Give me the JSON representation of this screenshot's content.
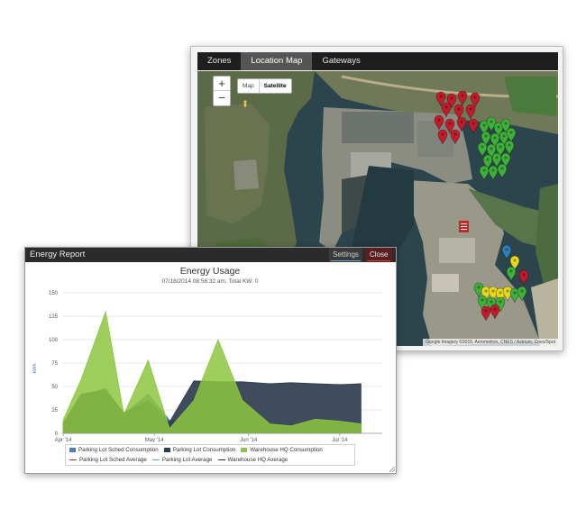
{
  "map_window": {
    "tabs": [
      {
        "label": "Zones",
        "active": false
      },
      {
        "label": "Location Map",
        "active": true
      },
      {
        "label": "Gateways",
        "active": false
      }
    ],
    "zoom_in": "+",
    "zoom_out": "−",
    "map_types": {
      "map": "Map",
      "satellite": "Satellite",
      "selected": "satellite"
    },
    "attribution": "Google Imagery ©2015, Aerometrex, CNES / Astrium, Cnes/Spot",
    "marker_colors": {
      "red": "#c21b2a",
      "green": "#3fae3a",
      "yellow": "#e6d81f",
      "blue": "#2f7fb5"
    }
  },
  "report_window": {
    "title": "Energy Report",
    "settings_label": "Settings",
    "close_label": "Close",
    "chart_data": {
      "type": "area",
      "title": "Energy Usage",
      "subtitle": "07/18/2014 08:56:32 am, Total KW: 0",
      "ylabel": "kWh",
      "ylim": [
        0,
        150
      ],
      "yticks": [
        0,
        25,
        50,
        75,
        100,
        125,
        150
      ],
      "x_tick_labels": [
        "Apr '14",
        "May '14",
        "Jun '14",
        "Jul '14"
      ],
      "x": [
        "2014-04-01",
        "2014-04-07",
        "2014-04-15",
        "2014-04-21",
        "2014-04-29",
        "2014-05-06",
        "2014-05-14",
        "2014-05-22",
        "2014-05-30",
        "2014-06-08",
        "2014-06-15",
        "2014-06-23",
        "2014-07-01",
        "2014-07-08"
      ],
      "series": [
        {
          "name": "Parking Lot Sched Consumption",
          "color": "#4a7fb8",
          "values": [
            10,
            40,
            48,
            20,
            42,
            14,
            10,
            10,
            11,
            10,
            9,
            10,
            10,
            10
          ]
        },
        {
          "name": "Parking Lot Consumption",
          "color": "#2e3d4f",
          "values": [
            10,
            42,
            46,
            22,
            35,
            12,
            56,
            55,
            55,
            53,
            54,
            53,
            52,
            53
          ]
        },
        {
          "name": "Warehouse HQ Consumption",
          "color": "#8dc63f",
          "values": [
            14,
            58,
            130,
            20,
            78,
            5,
            35,
            100,
            35,
            10,
            8,
            15,
            13,
            10
          ]
        }
      ],
      "legend_extra": [
        {
          "name": "Parking Lot Sched Average",
          "color": "#c0392b"
        },
        {
          "name": "Parking Lot Average",
          "color": "#4aa3df"
        },
        {
          "name": "Warehouse HQ Average",
          "color": "#333333"
        }
      ],
      "grid": true,
      "legend_position": "bottom"
    }
  }
}
